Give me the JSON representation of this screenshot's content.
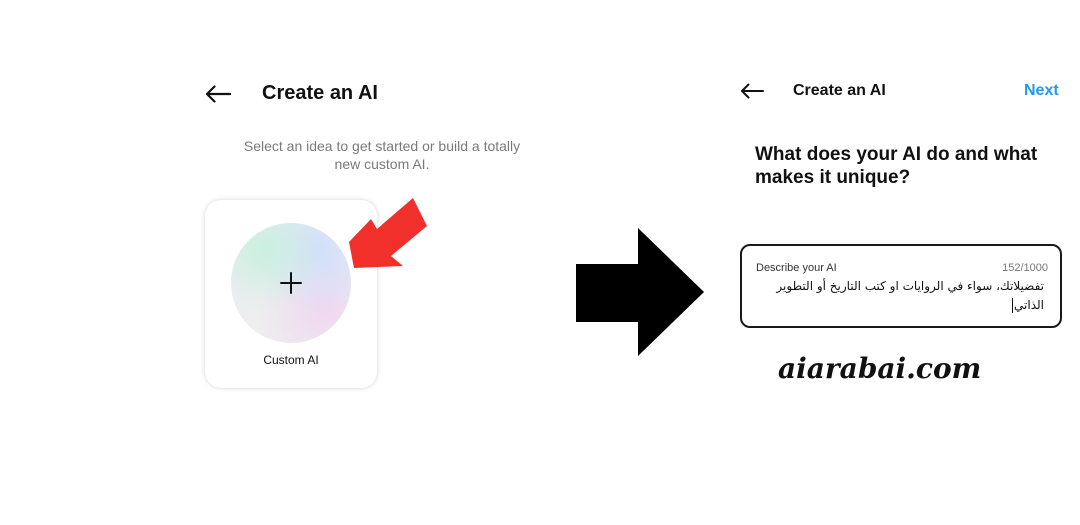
{
  "left_screen": {
    "back_icon": "arrow-left-icon",
    "title": "Create an AI",
    "subtitle": "Select an idea to get started or build a totally new custom AI.",
    "custom_card": {
      "icon": "plus-icon",
      "label": "Custom AI"
    },
    "pointer_icon": "red-pointer-arrow-icon"
  },
  "transition_icon": "black-right-arrow-icon",
  "right_screen": {
    "back_icon": "arrow-left-icon",
    "title": "Create an AI",
    "next_label": "Next",
    "question": "What does your AI do and what makes it unique?",
    "description_field": {
      "label": "Describe your AI",
      "counter": "152/1000",
      "value": "تفضيلاتك، سواء في الروايات او كتب التاريخ أو التطوير\nالذاتي"
    }
  },
  "watermark": "aiarabai.com",
  "colors": {
    "accent": "#1d9bf0",
    "pointer": "#f2302b",
    "text": "#111111",
    "muted": "#7a7a7a"
  }
}
